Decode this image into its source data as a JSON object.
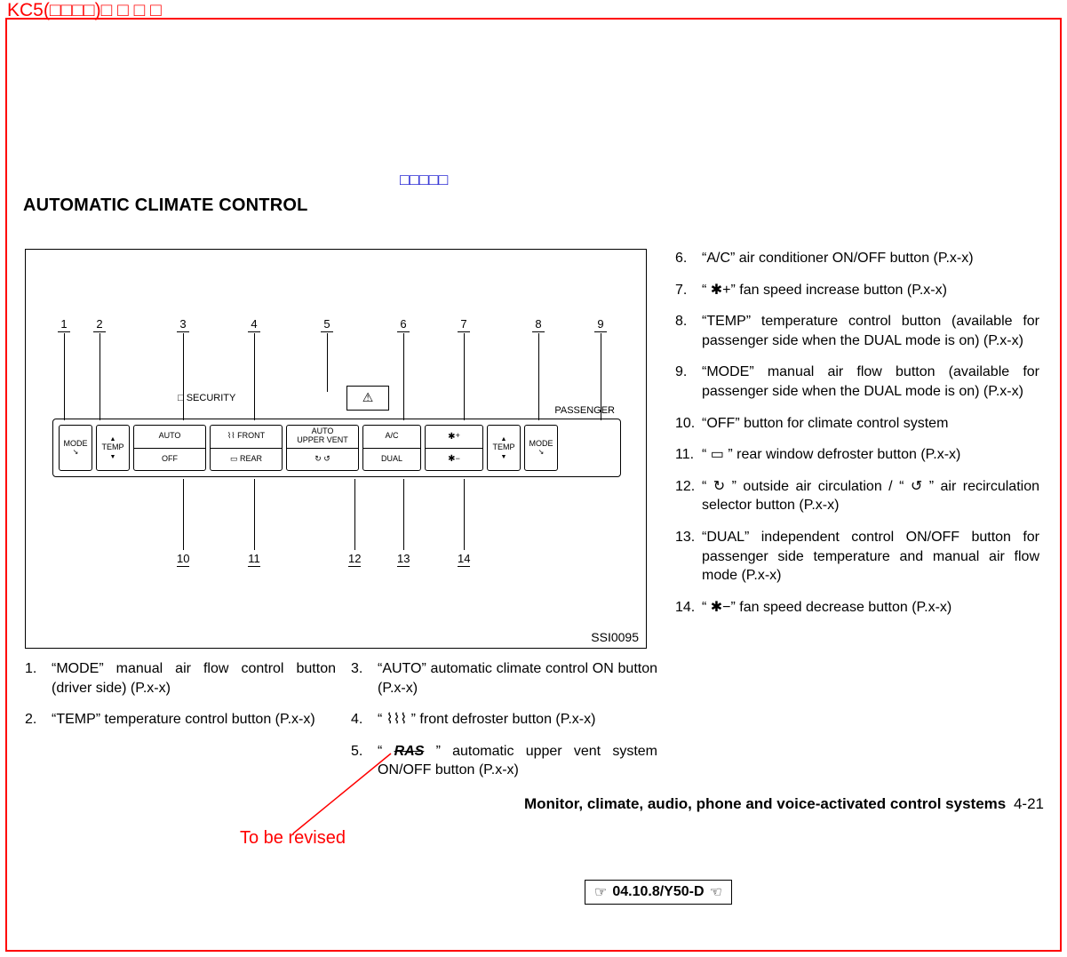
{
  "header": {
    "kc5": "KC5(□□□□)□ □ □ □",
    "blue_tag": "□□□□□"
  },
  "title": "AUTOMATIC CLIMATE CONTROL",
  "figure": {
    "id": "SSI0095",
    "labels": {
      "security": "SECURITY",
      "passenger": "PASSENGER",
      "hazard": "⚠"
    },
    "buttons": {
      "mode_l": "MODE",
      "temp_l": "TEMP",
      "auto": "AUTO",
      "off": "OFF",
      "front": "FRONT",
      "rear": "REAR",
      "upper": "AUTO\nUPPER VENT",
      "ac": "A/C",
      "dual": "DUAL",
      "fan_plus": "+",
      "fan_minus": "−",
      "temp_r": "TEMP",
      "mode_r": "MODE"
    },
    "callouts_top": [
      "1",
      "2",
      "3",
      "4",
      "5",
      "6",
      "7",
      "8",
      "9"
    ],
    "callouts_bottom": [
      "10",
      "11",
      "12",
      "13",
      "14"
    ]
  },
  "list_col1": [
    {
      "n": "1.",
      "t": "“MODE” manual air flow control button (driver side) (P.x-x)"
    },
    {
      "n": "2.",
      "t": "“TEMP” temperature control button (P.x-x)"
    }
  ],
  "list_col2": [
    {
      "n": "3.",
      "t": "“AUTO” automatic climate control ON button (P.x-x)"
    },
    {
      "n": "4.",
      "t": "“ ⌇⌇⌇ ” front defroster button (P.x-x)"
    },
    {
      "n": "5.",
      "pre": "“ ",
      "ras": "RAS",
      "post": " ”  automatic  upper  vent system ON/OFF button (P.x-x)"
    }
  ],
  "list_col3": [
    {
      "n": "6.",
      "t": "“A/C” air conditioner ON/OFF button (P.x-x)"
    },
    {
      "n": "7.",
      "t": "“ ✱+” fan speed increase button (P.x-x)"
    },
    {
      "n": "8.",
      "t": "“TEMP” temperature control button (available for passenger side when the DUAL mode is on) (P.x-x)"
    },
    {
      "n": "9.",
      "t": "“MODE” manual air flow button (available for passenger side when the DUAL mode is on) (P.x-x)"
    },
    {
      "n": "10.",
      "t": "“OFF” button for climate control system"
    },
    {
      "n": "11.",
      "t": "“ ▭ ” rear window defroster button (P.x-x)"
    },
    {
      "n": "12.",
      "t": "“ ↻ ” outside air circulation / “ ↺ ” air recirculation selector button (P.x-x)"
    },
    {
      "n": "13.",
      "t": "“DUAL” independent control ON/OFF button for passenger side temperature and manual air flow mode (P.x-x)"
    },
    {
      "n": "14.",
      "t": "“ ✱−” fan speed decrease button (P.x-x)"
    }
  ],
  "footer": {
    "section": "Monitor, climate, audio, phone and voice-activated control systems",
    "page": "4-21",
    "revised": "To be revised",
    "date": "04.10.8/Y50-D"
  }
}
